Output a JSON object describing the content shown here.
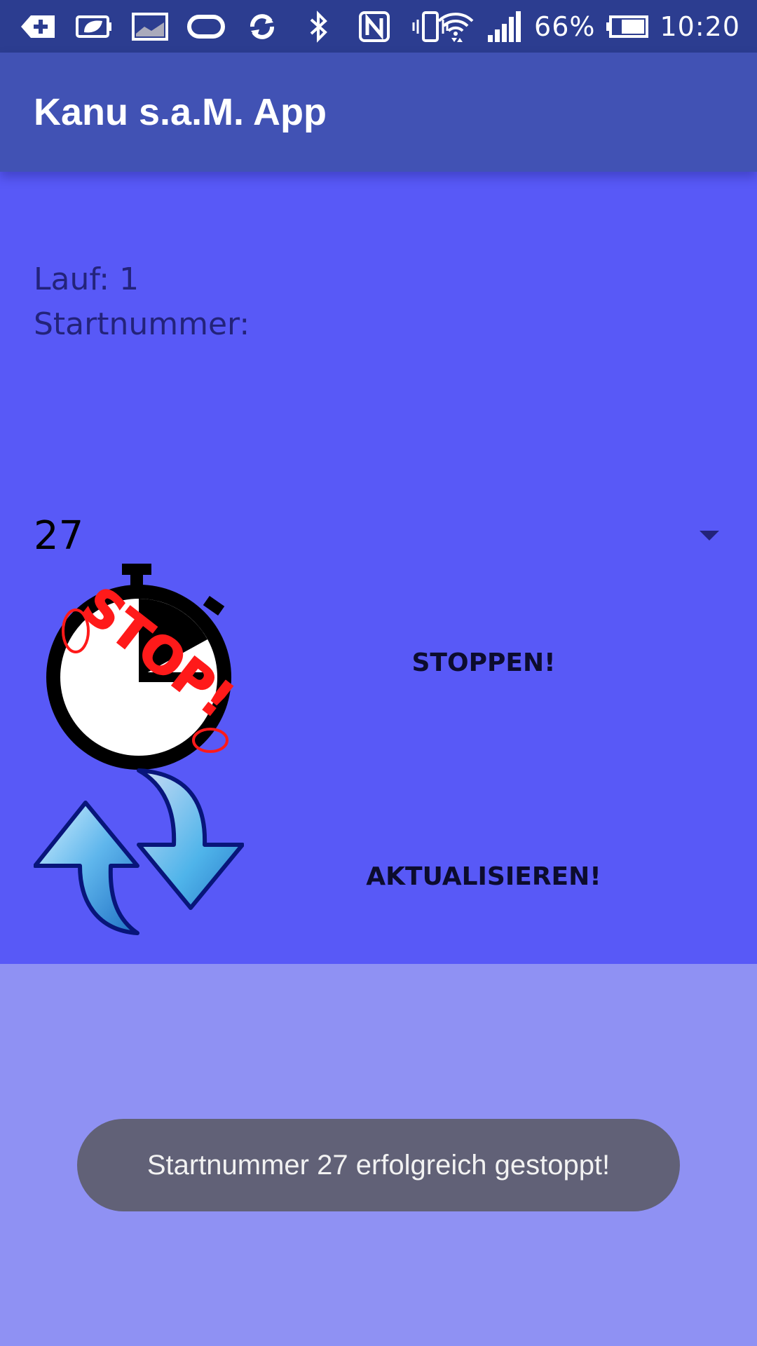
{
  "status_bar": {
    "battery_percent": "66%",
    "time": "10:20",
    "icons": [
      "back-plus-icon",
      "battery-saver-icon",
      "image-icon",
      "rounded-rect-icon",
      "sync-icon",
      "bluetooth-icon",
      "nfc-icon",
      "vibrate-icon",
      "wifi-icon",
      "signal-icon",
      "battery-icon"
    ]
  },
  "app_bar": {
    "title": "Kanu s.a.M. App"
  },
  "run": {
    "text": "Lauf: 1"
  },
  "start_number": {
    "label": "Startnummer:"
  },
  "spinner": {
    "selected_value": "27"
  },
  "stop_button": {
    "label": "STOPPEN!",
    "icon_text": "STOP!"
  },
  "refresh_button": {
    "label": "AKTUALISIEREN!"
  },
  "toast": {
    "message": "Startnummer 27 erfolgreich gestoppt!"
  },
  "colors": {
    "status_bar": "#2c3d90",
    "app_bar": "#4152b4",
    "content_background": "#5859f7",
    "lower_background": "#8f91f3",
    "toast_background": "#616177"
  }
}
